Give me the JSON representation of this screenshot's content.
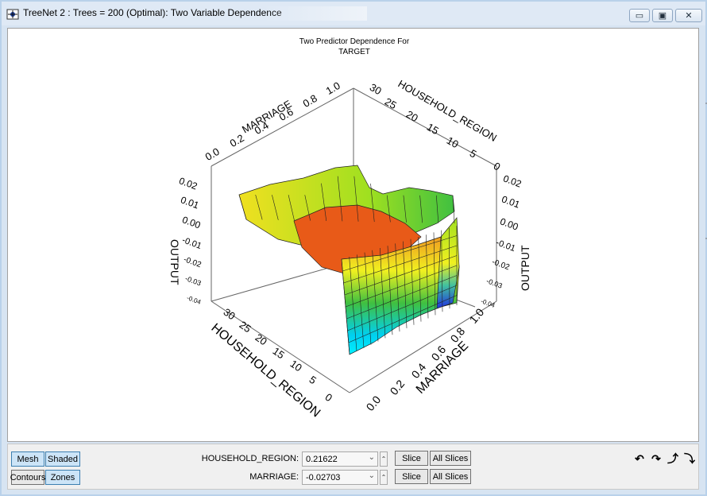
{
  "window": {
    "title": "TreeNet 2 : Trees = 200 (Optimal): Two Variable Dependence",
    "controls": [
      "minimize",
      "maximize",
      "close"
    ]
  },
  "chart_data": {
    "type": "surface3d",
    "title": "Two Predictor Dependence For",
    "subtitle": "TARGET",
    "axes": {
      "marriage_label": "MARRIAGE",
      "household_label": "HOUSEHOLD_REGION",
      "output_label": "OUTPUT",
      "marriage_ticks_back": [
        "0.0",
        "0.2",
        "0.4",
        "0.6",
        "0.8",
        "1.0"
      ],
      "marriage_ticks_front": [
        "0.0",
        "0.2",
        "0.4",
        "0.6",
        "0.8",
        "1.0"
      ],
      "household_ticks_back": [
        "30",
        "25",
        "20",
        "15",
        "10",
        "5",
        "0"
      ],
      "household_ticks_front": [
        "30",
        "25",
        "20",
        "15",
        "10",
        "5",
        "0"
      ],
      "output_ticks_left": [
        "0.02",
        "0.01",
        "0.00",
        "-0.01",
        "-0.02",
        "-0.03",
        "-0.04"
      ],
      "output_ticks_right": [
        "0.02",
        "0.01",
        "0.00",
        "-0.01",
        "-0.02",
        "-0.03",
        "-0.04"
      ],
      "marriage_range": [
        0,
        1
      ],
      "household_range": [
        0,
        30
      ],
      "output_range": [
        -0.04,
        0.02
      ]
    },
    "colormap": [
      "#00f0ff",
      "#38d0a0",
      "#40c040",
      "#a0e020",
      "#f0f020",
      "#f08020",
      "#e04010"
    ]
  },
  "controls": {
    "mesh": "Mesh",
    "shaded": "Shaded",
    "contours": "Contours",
    "zones": "Zones",
    "household_label": "HOUSEHOLD_REGION:",
    "household_value": "0.21622",
    "marriage_label": "MARRIAGE:",
    "marriage_value": "-0.02703",
    "slice": "Slice",
    "all_slices": "All Slices",
    "rotate_icons": [
      "rotate-left-icon",
      "rotate-right-icon",
      "rotate-up-icon",
      "rotate-down-icon"
    ]
  }
}
